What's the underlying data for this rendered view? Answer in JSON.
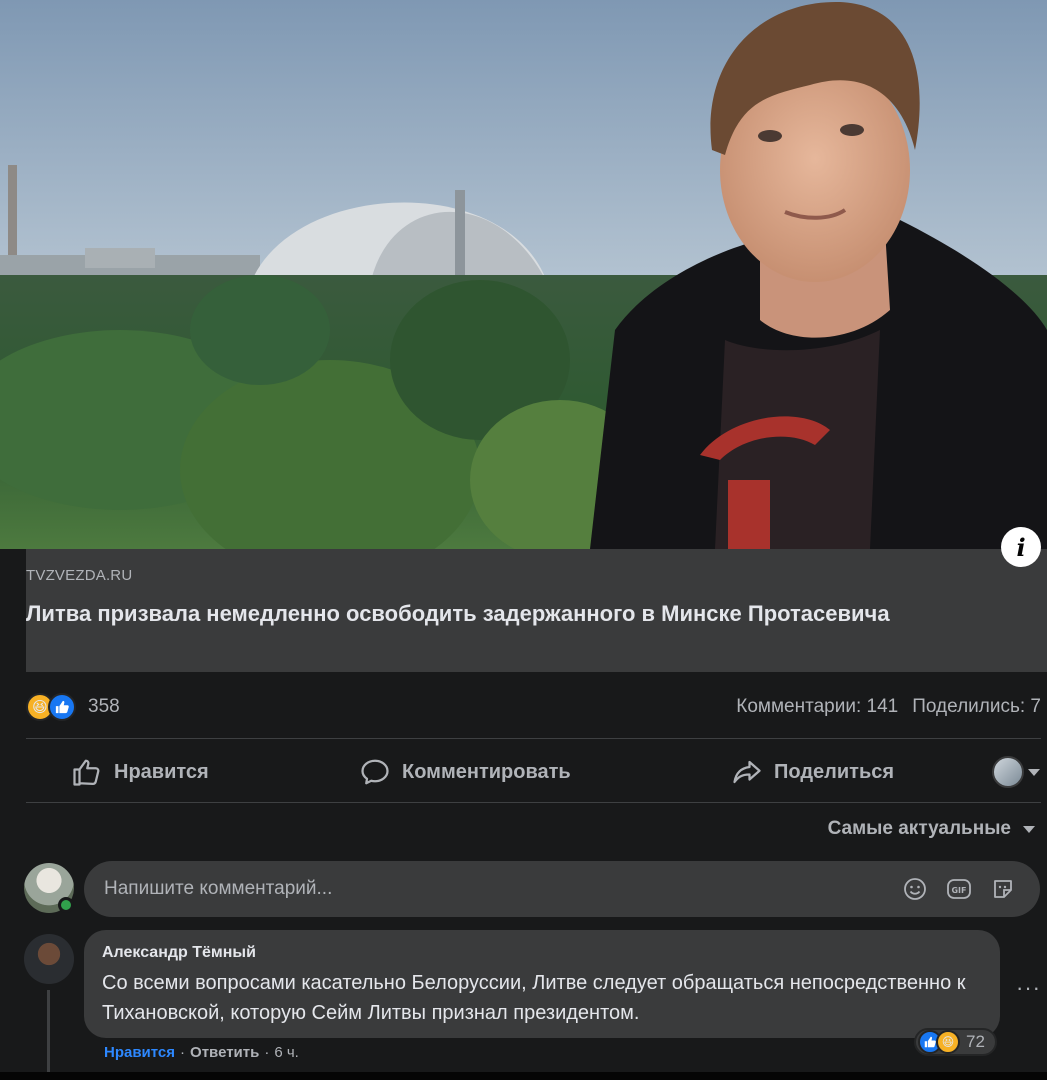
{
  "post": {
    "link": {
      "domain": "TVZVEZDA.RU",
      "title": "Литва призвала немедленно освободить задержанного в Минске Протасевича"
    },
    "reactions": {
      "types": [
        "haha",
        "like"
      ],
      "count": "358"
    },
    "comments_count": "Комментарии: 141",
    "shares_count": "Поделились: 7",
    "actions": {
      "like": "Нравится",
      "comment": "Комментировать",
      "share": "Поделиться"
    }
  },
  "comments": {
    "sort_label": "Самые актуальные",
    "composer_placeholder": "Напишите комментарий...",
    "items": [
      {
        "author": "Александр Тёмный",
        "text": "Со всеми вопросами касательно Белоруссии, Литве следует обращаться непосредственно к Тихановской, которую Сейм Литвы признал президентом.",
        "reactions": {
          "types": [
            "like",
            "haha"
          ],
          "count": "72"
        },
        "like_label": "Нравится",
        "reply_label": "Ответить",
        "time": "6 ч."
      }
    ]
  },
  "colors": {
    "background": "#18191a",
    "card": "#3a3b3c",
    "accent_blue": "#2d88ff",
    "like_blue": "#1877f2",
    "haha_yellow": "#f7b125",
    "online_green": "#31a24c"
  },
  "icons": [
    "info-icon",
    "haha-reaction-icon",
    "like-reaction-icon",
    "thumb-up-icon",
    "comment-icon",
    "share-icon",
    "emoji-icon",
    "gif-icon",
    "sticker-icon",
    "more-icon"
  ]
}
